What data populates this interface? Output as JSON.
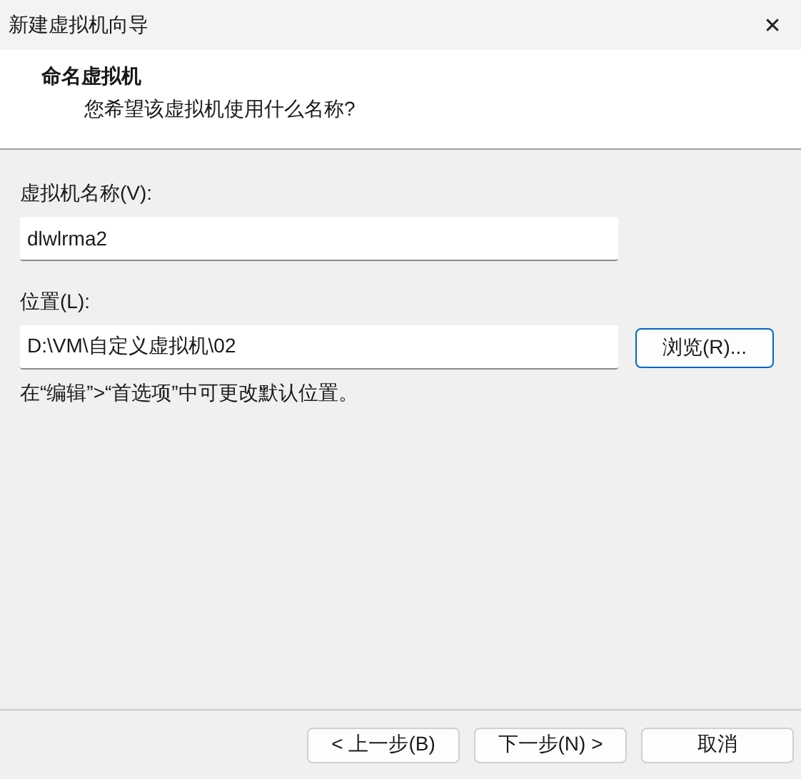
{
  "window": {
    "title": "新建虚拟机向导",
    "close": "✕"
  },
  "header": {
    "title": "命名虚拟机",
    "subtitle": "您希望该虚拟机使用什么名称?"
  },
  "fields": [
    {
      "label": "虚拟机名称(V):",
      "value": "dlwlrma2"
    },
    {
      "label": "位置(L):",
      "value": "D:\\VM\\自定义虚拟机\\02",
      "button": {
        "label": "浏览(R)...",
        "focused": true
      }
    }
  ],
  "note": "在“编辑”>“首选项”中可更改默认位置。",
  "buttons": [
    {
      "label": "< 上一步(B)",
      "focused": false
    },
    {
      "label": "下一步(N) >",
      "focused": false
    },
    {
      "label": "取消",
      "focused": false
    }
  ]
}
